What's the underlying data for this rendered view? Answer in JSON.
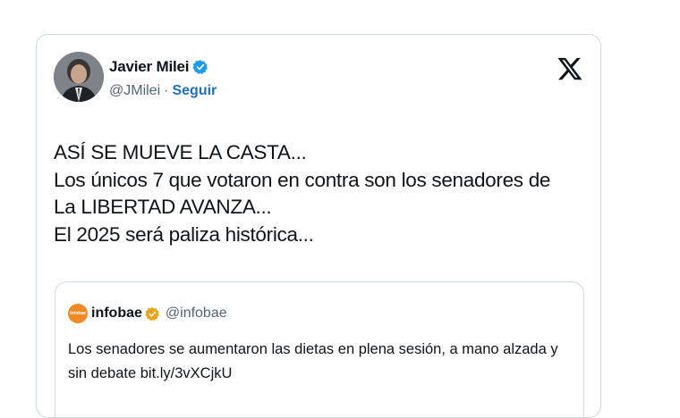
{
  "author": {
    "name": "Javier Milei",
    "handle": "@JMilei",
    "separator": "·",
    "follow_label": "Seguir",
    "verified_icon": "verified-badge-icon",
    "verified_color": "#1d9bf0"
  },
  "brand": {
    "logo_icon": "x-logo-icon"
  },
  "tweet": {
    "lines": [
      "ASÍ SE MUEVE LA CASTA...",
      "Los únicos 7 que votaron en contra son los senadores de",
      "La LIBERTAD AVANZA...",
      "El 2025 será paliza histórica..."
    ]
  },
  "quoted": {
    "name": "infobae",
    "handle": "@infobae",
    "avatar_text": "infobae",
    "avatar_color": "#f08a24",
    "verified_icon": "gold-verified-badge-icon",
    "verified_color": "#e8a317",
    "lines": [
      "Los senadores se aumentaron las dietas en plena sesión, a mano alzada y",
      "sin debate bit.ly/3vXCjkU"
    ]
  }
}
